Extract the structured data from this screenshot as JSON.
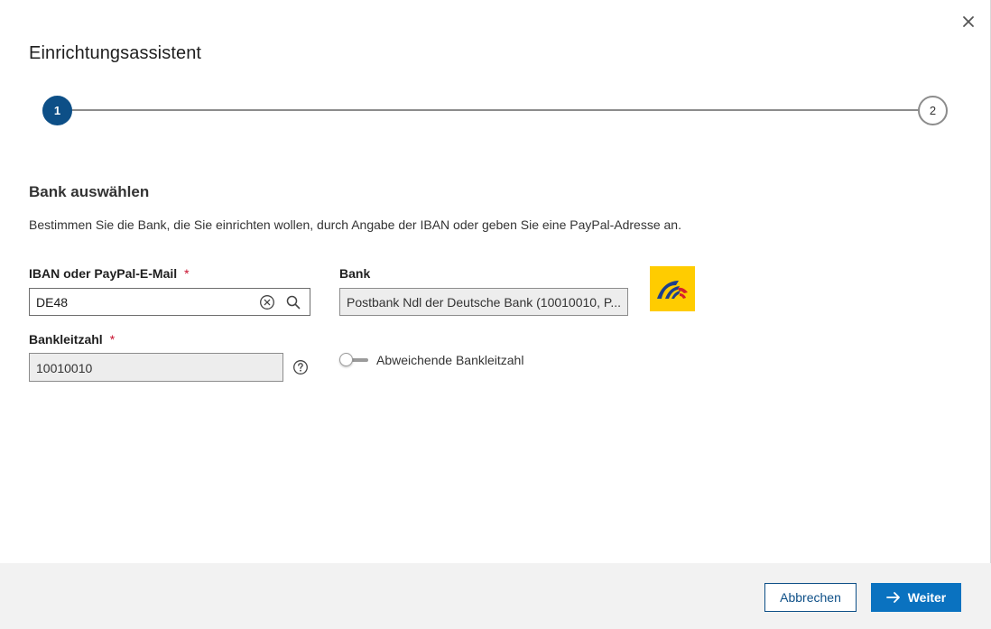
{
  "dialog": {
    "title": "Einrichtungsassistent",
    "close_icon": "close-icon"
  },
  "stepper": {
    "steps": [
      {
        "number": "1",
        "state": "active"
      },
      {
        "number": "2",
        "state": "inactive"
      }
    ],
    "active_color": "#0d4f87"
  },
  "section": {
    "title": "Bank auswählen",
    "description": "Bestimmen Sie die Bank, die Sie einrichten wollen, durch Angabe der IBAN oder geben Sie eine PayPal-Adresse an."
  },
  "form": {
    "iban": {
      "label": "IBAN oder PayPal-E-Mail",
      "required_mark": "*",
      "value": "DE48",
      "clear_icon": "clear-circle-icon",
      "search_icon": "search-icon"
    },
    "bank": {
      "label": "Bank",
      "value": "Postbank Ndl der Deutsche Bank (10010010, P...",
      "logo_icon": "postbank-logo"
    },
    "blz": {
      "label": "Bankleitzahl",
      "required_mark": "*",
      "value": "10010010",
      "help_icon": "help-circle-icon"
    },
    "toggle": {
      "label": "Abweichende Bankleitzahl",
      "state": "off"
    }
  },
  "footer": {
    "cancel_label": "Abbrechen",
    "next_label": "Weiter",
    "next_icon": "arrow-right-icon",
    "primary_color": "#0a72c0"
  }
}
